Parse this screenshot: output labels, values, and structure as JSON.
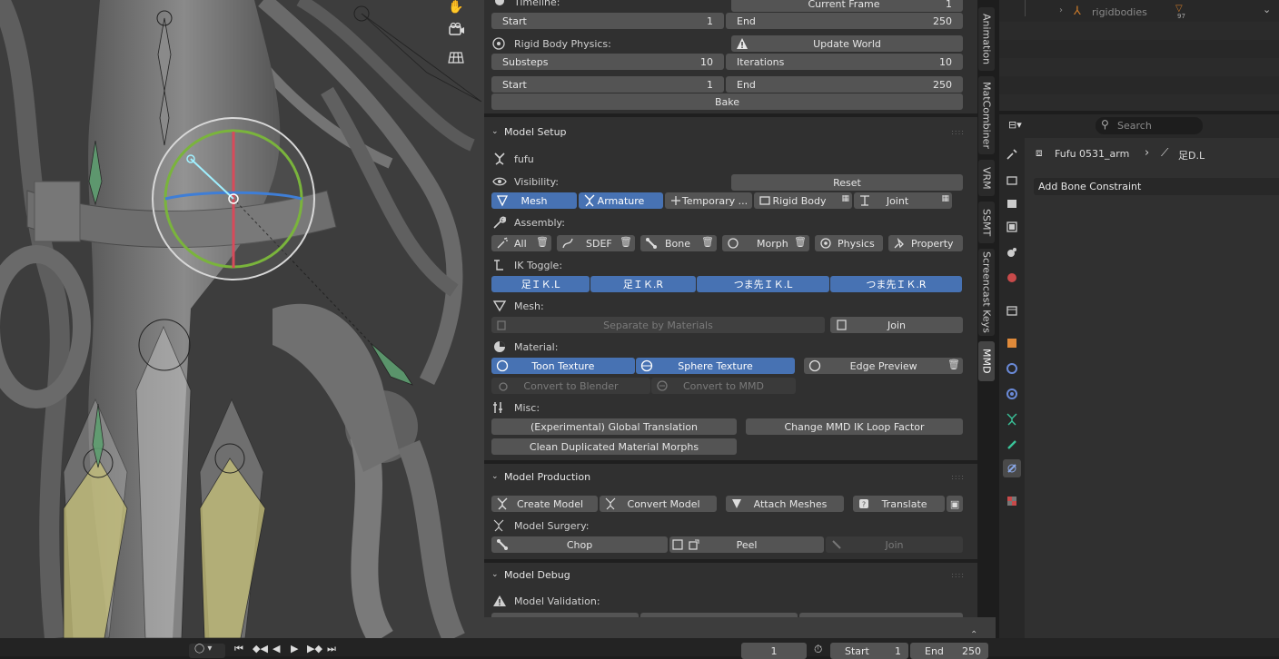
{
  "rigid_body": {
    "timeline_label": "Timeline:",
    "current_frame_label": "Current Frame",
    "current_frame_value": "1",
    "start_label": "Start",
    "start_value": "1",
    "end_label": "End",
    "end_value": "250",
    "physics_label": "Rigid Body Physics:",
    "update_world_label": "Update World",
    "substeps_label": "Substeps",
    "substeps_value": "10",
    "iterations_label": "Iterations",
    "iterations_value": "10",
    "start2_label": "Start",
    "start2_value": "1",
    "end2_label": "End",
    "end2_value": "250",
    "bake_label": "Bake"
  },
  "model_setup": {
    "title": "Model Setup",
    "model_name": "fufu",
    "visibility_label": "Visibility:",
    "reset_label": "Reset",
    "vis_buttons": [
      "Mesh",
      "Armature",
      "Temporary ...",
      "Rigid Body",
      "Joint"
    ],
    "assembly_label": "Assembly:",
    "assembly_buttons": [
      "All",
      "SDEF",
      "Bone",
      "Morph",
      "Physics",
      "Property"
    ],
    "ik_label": "IK Toggle:",
    "ik_buttons": [
      "足ＩＫ.L",
      "足ＩＫ.R",
      "つま先ＩＫ.L",
      "つま先ＩＫ.R"
    ],
    "mesh_label": "Mesh:",
    "separate_label": "Separate by Materials",
    "join_label": "Join",
    "material_label": "Material:",
    "toon_label": "Toon Texture",
    "sphere_label": "Sphere Texture",
    "edge_label": "Edge Preview",
    "convert_blender_label": "Convert to Blender",
    "convert_mmd_label": "Convert to MMD",
    "misc_label": "Misc:",
    "global_translation_label": "(Experimental) Global Translation",
    "ik_loop_label": "Change MMD IK Loop Factor",
    "clean_morphs_label": "Clean Duplicated Material Morphs"
  },
  "model_production": {
    "title": "Model Production",
    "create_label": "Create Model",
    "convert_label": "Convert Model",
    "attach_label": "Attach Meshes",
    "translate_label": "Translate",
    "surgery_label": "Model Surgery:",
    "chop_label": "Chop",
    "peel_label": "Peel",
    "join_label": "Join"
  },
  "model_debug": {
    "title": "Model Debug",
    "validation_label": "Model Validation:"
  },
  "sidebar_tabs": [
    "Animation",
    "MatCombiner",
    "VRM",
    "SSMT",
    "Screencast Keys",
    "MMD"
  ],
  "outliner": {
    "item_label": "rigidbodies",
    "item_count": "97"
  },
  "properties": {
    "search_placeholder": "Search",
    "object_name": "Fufu 0531_arm",
    "bone_name": "足D.L",
    "add_constraint_label": "Add Bone Constraint"
  },
  "timeline": {
    "current_frame": "1",
    "start_label": "Start",
    "start_value": "1",
    "end_label": "End",
    "end_value": "250"
  },
  "colors": {
    "accent_blue": "#4772b3",
    "panel_bg": "#303030",
    "button_bg": "#545454"
  }
}
